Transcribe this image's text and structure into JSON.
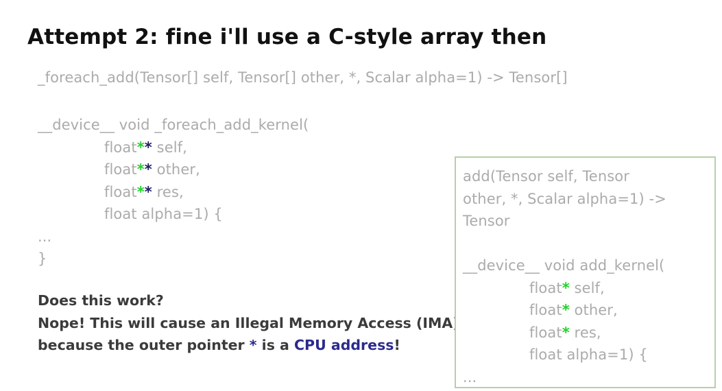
{
  "title": "Attempt 2: fine i'll use a C-style array then",
  "foreach_signature": "_foreach_add(Tensor[] self, Tensor[] other, *, Scalar alpha=1) -> Tensor[]",
  "foreach_kernel": {
    "header": "__device__ void _foreach_add_kernel(",
    "params": [
      {
        "type": "float",
        "stars": "**",
        "name": " self,"
      },
      {
        "type": "float",
        "stars": "**",
        "name": " other,"
      },
      {
        "type": "float",
        "stars": "**",
        "name": " res,"
      }
    ],
    "last_param": "float alpha=1) {",
    "ellipsis": "...",
    "close": "}"
  },
  "explanation": {
    "question": "Does this work?",
    "answer": "Nope! This will cause an Illegal Memory Access (IMA)",
    "reason_prefix": "because the outer pointer ",
    "reason_star": "*",
    "reason_middle": " is a ",
    "reason_highlight": "CPU address",
    "reason_suffix": "!"
  },
  "single_box": {
    "signature_lines": [
      "add(Tensor self, Tensor",
      "other, *, Scalar alpha=1) ->",
      "Tensor"
    ],
    "header": "__device__ void add_kernel(",
    "params": [
      {
        "type": "float",
        "stars": "*",
        "name": " self,"
      },
      {
        "type": "float",
        "stars": "*",
        "name": " other,"
      },
      {
        "type": "float",
        "stars": "*",
        "name": " res,"
      }
    ],
    "last_param": "float alpha=1) {",
    "ellipsis": "..."
  },
  "colors": {
    "code_gray": "#ababab",
    "star_green": "#22d12b",
    "star_navy": "#1d1d66",
    "box_border": "#b6cfa8",
    "cpu_highlight": "#2b2a8c"
  }
}
